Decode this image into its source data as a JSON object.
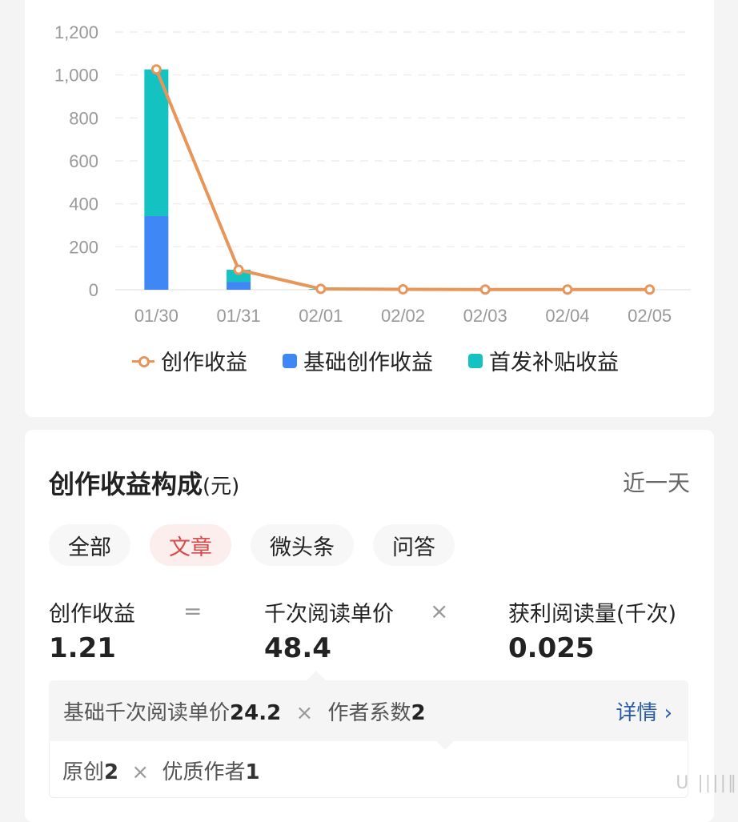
{
  "chart_data": {
    "type": "bar",
    "stacked": true,
    "categories": [
      "01/30",
      "01/31",
      "02/01",
      "02/02",
      "02/03",
      "02/04",
      "02/05"
    ],
    "series": [
      {
        "name": "基础创作收益",
        "kind": "bar",
        "color": "#3e87f5",
        "values": [
          343,
          37,
          0,
          0,
          0,
          0,
          0
        ]
      },
      {
        "name": "首发补贴收益",
        "kind": "bar",
        "color": "#14c2c2",
        "values": [
          683,
          56,
          3,
          0,
          0,
          0,
          0
        ]
      },
      {
        "name": "创作收益",
        "kind": "line",
        "color": "#e8955a",
        "values": [
          1026,
          93,
          4,
          2,
          1,
          1,
          1
        ]
      }
    ],
    "yticks": [
      "1,200",
      "1,000",
      "800",
      "600",
      "400",
      "200",
      "0"
    ],
    "ylim": [
      0,
      1200
    ],
    "grid": true,
    "legend": "bottom",
    "title": "",
    "xlabel": "",
    "ylabel": ""
  },
  "legend": {
    "items": [
      "创作收益",
      "基础创作收益",
      "首发补贴收益"
    ]
  },
  "composition": {
    "title": "创作收益构成",
    "unit": "(元)",
    "range": "近一天",
    "tabs": [
      "全部",
      "文章",
      "微头条",
      "问答"
    ],
    "active_tab": "文章",
    "formula": {
      "income_label": "创作收益",
      "income_value": "1.21",
      "equals": "=",
      "cpm_label": "千次阅读单价",
      "cpm_value": "48.4",
      "times": "×",
      "reads_label": "获利阅读量(千次)",
      "reads_value": "0.025"
    },
    "detail": {
      "base_label": "基础千次阅读单价",
      "base_value": "24.2",
      "times": "×",
      "coef_label": "作者系数",
      "coef_value": "2",
      "link": "详情 ›"
    },
    "sub": {
      "original_label": "原创",
      "original_value": "2",
      "times": "×",
      "quality_label": "优质作者",
      "quality_value": "1"
    }
  }
}
